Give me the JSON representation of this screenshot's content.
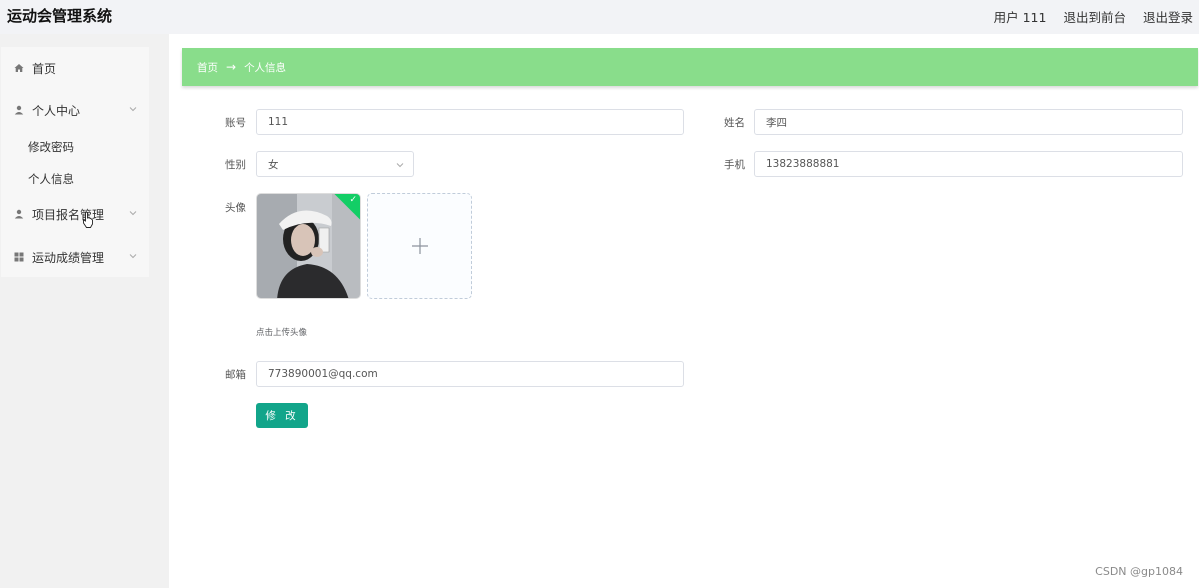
{
  "header": {
    "app_title": "运动会管理系统",
    "user_label": "用户 111",
    "goto_front": "退出到前台",
    "logout": "退出登录"
  },
  "sidebar": {
    "items": [
      {
        "label": "首页",
        "icon": "home-icon"
      },
      {
        "label": "个人中心",
        "icon": "user-icon",
        "expanded": true,
        "children": [
          {
            "label": "修改密码"
          },
          {
            "label": "个人信息"
          }
        ]
      },
      {
        "label": "项目报名管理",
        "icon": "user-icon"
      },
      {
        "label": "运动成绩管理",
        "icon": "grid-icon"
      }
    ]
  },
  "breadcrumb": {
    "home": "首页",
    "arrow": "→",
    "current": "个人信息"
  },
  "form": {
    "account": {
      "label": "账号",
      "value": "111"
    },
    "name": {
      "label": "姓名",
      "value": "李四"
    },
    "gender": {
      "label": "性别",
      "value": "女"
    },
    "phone": {
      "label": "手机",
      "value": "13823888881"
    },
    "avatar": {
      "label": "头像",
      "hint": "点击上传头像"
    },
    "email": {
      "label": "邮箱",
      "value": "773890001@qq.com"
    },
    "submit_label": "修 改"
  },
  "watermark": "CSDN @gp1084",
  "colors": {
    "breadcrumb_bg": "#89dd8b",
    "primary_button": "#12a58a",
    "upload_success": "#13ce66"
  }
}
